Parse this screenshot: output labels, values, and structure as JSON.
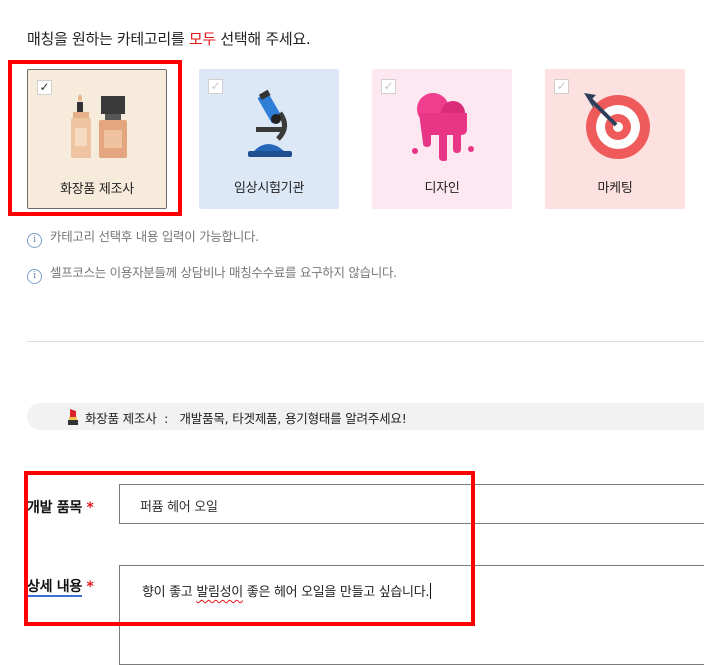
{
  "intro": {
    "before": "매칭을 원하는 카테고리를 ",
    "accent": "모두",
    "after": " 선택해 주세요."
  },
  "categories": [
    {
      "label": "화장품 제조사",
      "checked": true,
      "icon": "cosmetics-bottles-icon",
      "bg": "#f7ecdc"
    },
    {
      "label": "임상시험기관",
      "checked": false,
      "icon": "microscope-icon",
      "bg": "#dde8f6"
    },
    {
      "label": "디자인",
      "checked": false,
      "icon": "paint-splash-icon",
      "bg": "#fde7f1"
    },
    {
      "label": "마케팅",
      "checked": false,
      "icon": "target-dart-icon",
      "bg": "#fde0e0"
    }
  ],
  "notes": [
    "카테고리 선택후 내용 입력이 가능합니다.",
    "셀프코스는 이용자분들께 상담비나 매칭수수료를 요구하지 않습니다."
  ],
  "banner": {
    "category": "화장품 제조사",
    "separator": ":",
    "message": "개발품목, 타겟제품, 용기형태를 알려주세요!"
  },
  "form": {
    "product_label": "개발 품목",
    "product_value": "퍼퓸 헤어 오일",
    "detail_label": "상세 내용",
    "required_mark": "*",
    "detail_value_a": "향이 좋고 ",
    "detail_value_b": "발림성이",
    "detail_value_c": " 좋은 헤어 오일을 만들고 싶습니다."
  },
  "colors": {
    "accent_red": "#e3161b",
    "highlight": "#ff0000",
    "underline_blue": "#3c6fd6"
  }
}
